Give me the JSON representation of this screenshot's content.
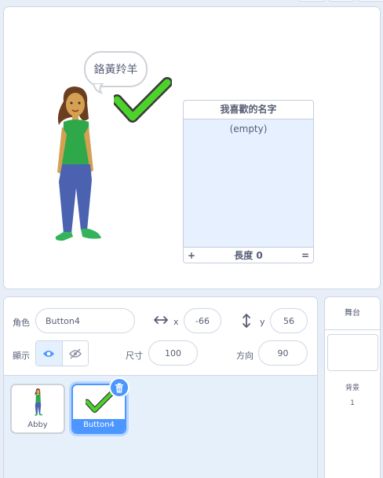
{
  "stage": {
    "speech_bubble": "鉻黃羚羊",
    "list_monitor": {
      "title": "我喜歡的名字",
      "empty_text": "(empty)",
      "add_label": "+",
      "length_label": "長度 0",
      "resize_label": "="
    }
  },
  "sprite_info": {
    "sprite_label": "角色",
    "sprite_name": "Button4",
    "x_label": "x",
    "x_value": "-66",
    "y_label": "y",
    "y_value": "56",
    "show_label": "顯示",
    "size_label": "尺寸",
    "size_value": "100",
    "direction_label": "方向",
    "direction_value": "90"
  },
  "sprites": [
    {
      "name": "Abby",
      "selected": false
    },
    {
      "name": "Button4",
      "selected": true
    }
  ],
  "stage_panel": {
    "title": "舞台",
    "backdrops_label": "背景",
    "backdrops_count": "1"
  },
  "colors": {
    "accent": "#4c97ff",
    "check_green": "#4cd22a",
    "panel_bg": "#e6f0fb",
    "text": "#575e75"
  }
}
